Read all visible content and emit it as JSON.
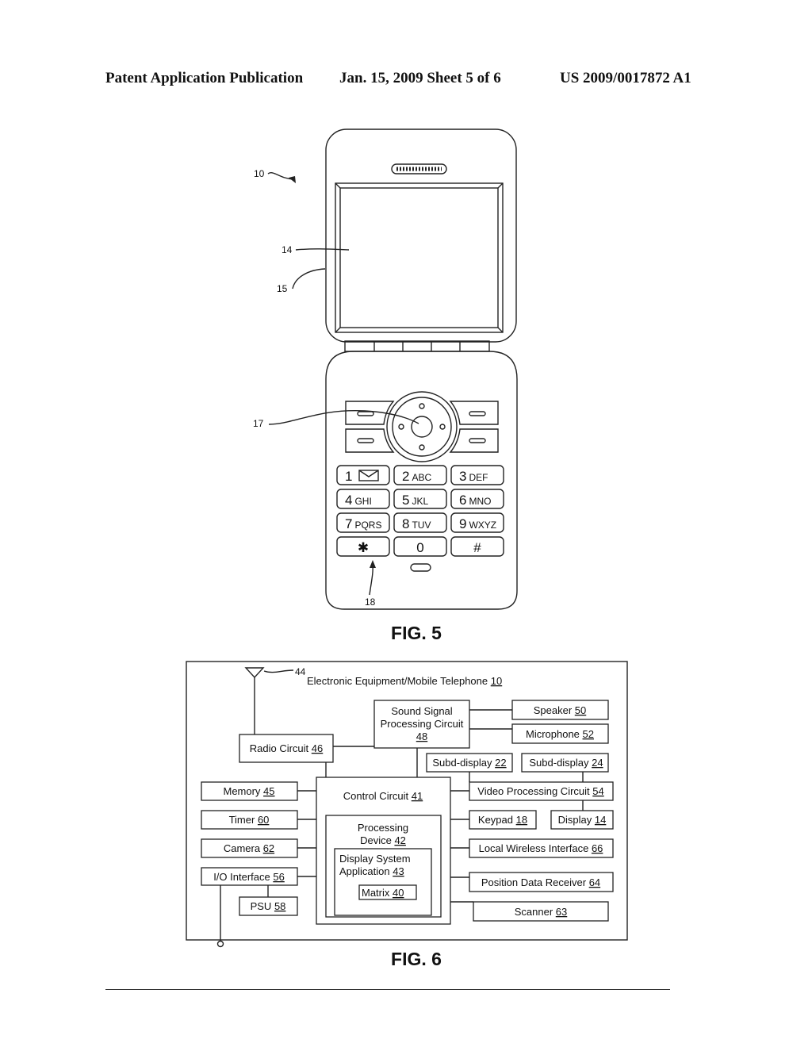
{
  "header": {
    "left": "Patent Application Publication",
    "center": "Jan. 15, 2009  Sheet 5 of 6",
    "right": "US 2009/0017872 A1"
  },
  "fig5": {
    "caption": "FIG. 5",
    "refs": {
      "device": "10",
      "display": "14",
      "housing": "15",
      "navigation": "17",
      "keypad": "18"
    },
    "keys": [
      {
        "digit": "1",
        "letters": "",
        "icon": "envelope-icon"
      },
      {
        "digit": "2",
        "letters": "ABC"
      },
      {
        "digit": "3",
        "letters": "DEF"
      },
      {
        "digit": "4",
        "letters": "GHI"
      },
      {
        "digit": "5",
        "letters": "JKL"
      },
      {
        "digit": "6",
        "letters": "MNO"
      },
      {
        "digit": "7",
        "letters": "PQRS"
      },
      {
        "digit": "8",
        "letters": "TUV"
      },
      {
        "digit": "9",
        "letters": "WXYZ"
      },
      {
        "digit": "✱",
        "letters": ""
      },
      {
        "digit": "0",
        "letters": ""
      },
      {
        "digit": "#",
        "letters": ""
      }
    ]
  },
  "fig6": {
    "caption": "FIG. 6",
    "antenna_ref": "44",
    "title": {
      "text": "Electronic Equipment/Mobile Telephone ",
      "ref": "10"
    },
    "blocks": {
      "sound": {
        "line1": "Sound Signal",
        "line2": "Processing Circuit",
        "ref": "48"
      },
      "speaker": {
        "text": "Speaker ",
        "ref": "50"
      },
      "microphone": {
        "text": "Microphone ",
        "ref": "52"
      },
      "radio": {
        "text": "Radio Circuit ",
        "ref": "46"
      },
      "subd22": {
        "text": "Subd-display  ",
        "ref": "22"
      },
      "subd24": {
        "text": "Subd-display  ",
        "ref": "24"
      },
      "control": {
        "text": "Control Circuit ",
        "ref": "41"
      },
      "video": {
        "text": "Video Processing Circuit ",
        "ref": "54"
      },
      "memory": {
        "text": "Memory ",
        "ref": "45"
      },
      "timer": {
        "text": "Timer ",
        "ref": "60"
      },
      "camera": {
        "text": "Camera ",
        "ref": "62"
      },
      "io": {
        "text": "I/O Interface ",
        "ref": "56"
      },
      "psu": {
        "text": "PSU ",
        "ref": "58"
      },
      "processing": {
        "line1": "Processing",
        "line2": "Device ",
        "ref": "42"
      },
      "dsa": {
        "line1": "Display System",
        "line2": "Application ",
        "ref": "43"
      },
      "matrix": {
        "text": "Matrix ",
        "ref": "40"
      },
      "keypad": {
        "text": "Keypad ",
        "ref": "18"
      },
      "display": {
        "text": "Display ",
        "ref": "14"
      },
      "lwi": {
        "text": "Local Wireless Interface ",
        "ref": "66"
      },
      "pdr": {
        "text": "Position Data Receiver ",
        "ref": "64"
      },
      "scanner": {
        "text": "Scanner ",
        "ref": "63"
      }
    }
  }
}
